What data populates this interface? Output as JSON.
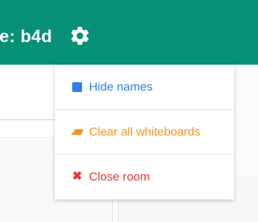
{
  "header": {
    "room_label": "e: b4d",
    "settings_icon": "gear-icon",
    "color": "#069078"
  },
  "menu": {
    "items": [
      {
        "label": "Hide names",
        "icon": "square-icon",
        "color": "#2f80ed"
      },
      {
        "label": "Clear all whiteboards",
        "icon": "eraser-icon",
        "color": "#f5941d"
      },
      {
        "label": "Close room",
        "icon": "close-icon",
        "color": "#e53935",
        "glyph": "✖"
      }
    ]
  }
}
